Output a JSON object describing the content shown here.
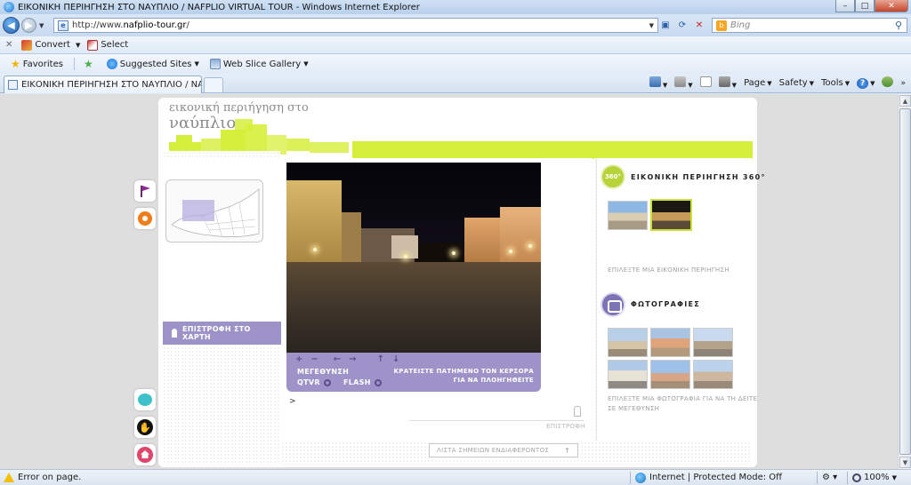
{
  "window": {
    "title": "ΕΙΚΟΝΙΚΗ ΠΕΡΙΗΓΗΣΗ ΣΤΟ ΝΑΥΠΛΙΟ / NAFPLIO VIRTUAL TOUR - Windows Internet Explorer",
    "minimize": "–",
    "maximize": "□",
    "close": "✕"
  },
  "address_bar": {
    "url_prefix": "http://www.",
    "url_domain": "nafplio-tour.gr",
    "url_suffix": "/"
  },
  "search": {
    "placeholder": "Bing"
  },
  "command_bar": {
    "convert": "Convert",
    "select": "Select"
  },
  "favorites_bar": {
    "favorites": "Favorites",
    "suggested_sites": "Suggested Sites",
    "web_slice_gallery": "Web Slice Gallery"
  },
  "tab": {
    "title": "ΕΙΚΟΝΙΚΗ ΠΕΡΙΗΓΗΣΗ ΣΤΟ ΝΑΥΠΛΙΟ / NAFPLIO..."
  },
  "tools": {
    "page": "Page",
    "safety": "Safety",
    "tools": "Tools"
  },
  "site": {
    "brand_line1": "εικονική περιήγηση στο",
    "brand_line2": "ναύπλιο",
    "back_to_map": "ΕΠΙΣΤΡΟΦΗ ΣΤΟ ΧΑΡΤΗ",
    "controls": {
      "magnify": "ΜΕΓΕΘΥΝΣΗ",
      "qtvr": "QTVR",
      "flash": "FLASH",
      "drag_hint_1": "ΚΡΑΤΕΙΣΤΕ ΠΑΤΗΜΕΝΟ ΤΟΝ ΚΕΡΣΟΡΑ",
      "drag_hint_2": "ΓΙΑ ΝΑ ΠΛΟΗΓΗΘΕΙΤΕ"
    },
    "cursor_mark": ">",
    "return_label": "ΕΠΙΣΤΡΟΦΗ",
    "virtual_tour_title": "ΕΙΚΟΝΙΚΗ ΠΕΡΙΗΓΗΣΗ 360°",
    "badge_360": "360°",
    "choose_tour_hint": "ΕΠΙΛΕΞΤΕ ΜΙΑ ΕΙΚΟΝΙΚΗ ΠΕΡΙΗΓΗΣΗ",
    "photos_title": "ΦΩΤΟΓΡΑΦΙΕΣ",
    "photo_hint_1": "ΕΠΙΛΕΞΤΕ ΜΙΑ ΦΩΤΟΓΡΑΦΙΑ ΓΙΑ ΝΑ ΤΗ ΔΕΙΤΕ",
    "photo_hint_2": "ΣΕ ΜΕΓΕΘΥΝΣΗ",
    "poi_list": "ΛΙΣΤΑ ΣΗΜΕΙΩΝ ΕΝΔΙΑΦΕΡΟΝΤΟΣ"
  },
  "status_bar": {
    "error": "Error on page.",
    "zone": "Internet | Protected Mode: Off",
    "zoom": "100%"
  },
  "colors": {
    "accent_green": "#d6ef3a",
    "accent_purple": "#9e93c9"
  }
}
